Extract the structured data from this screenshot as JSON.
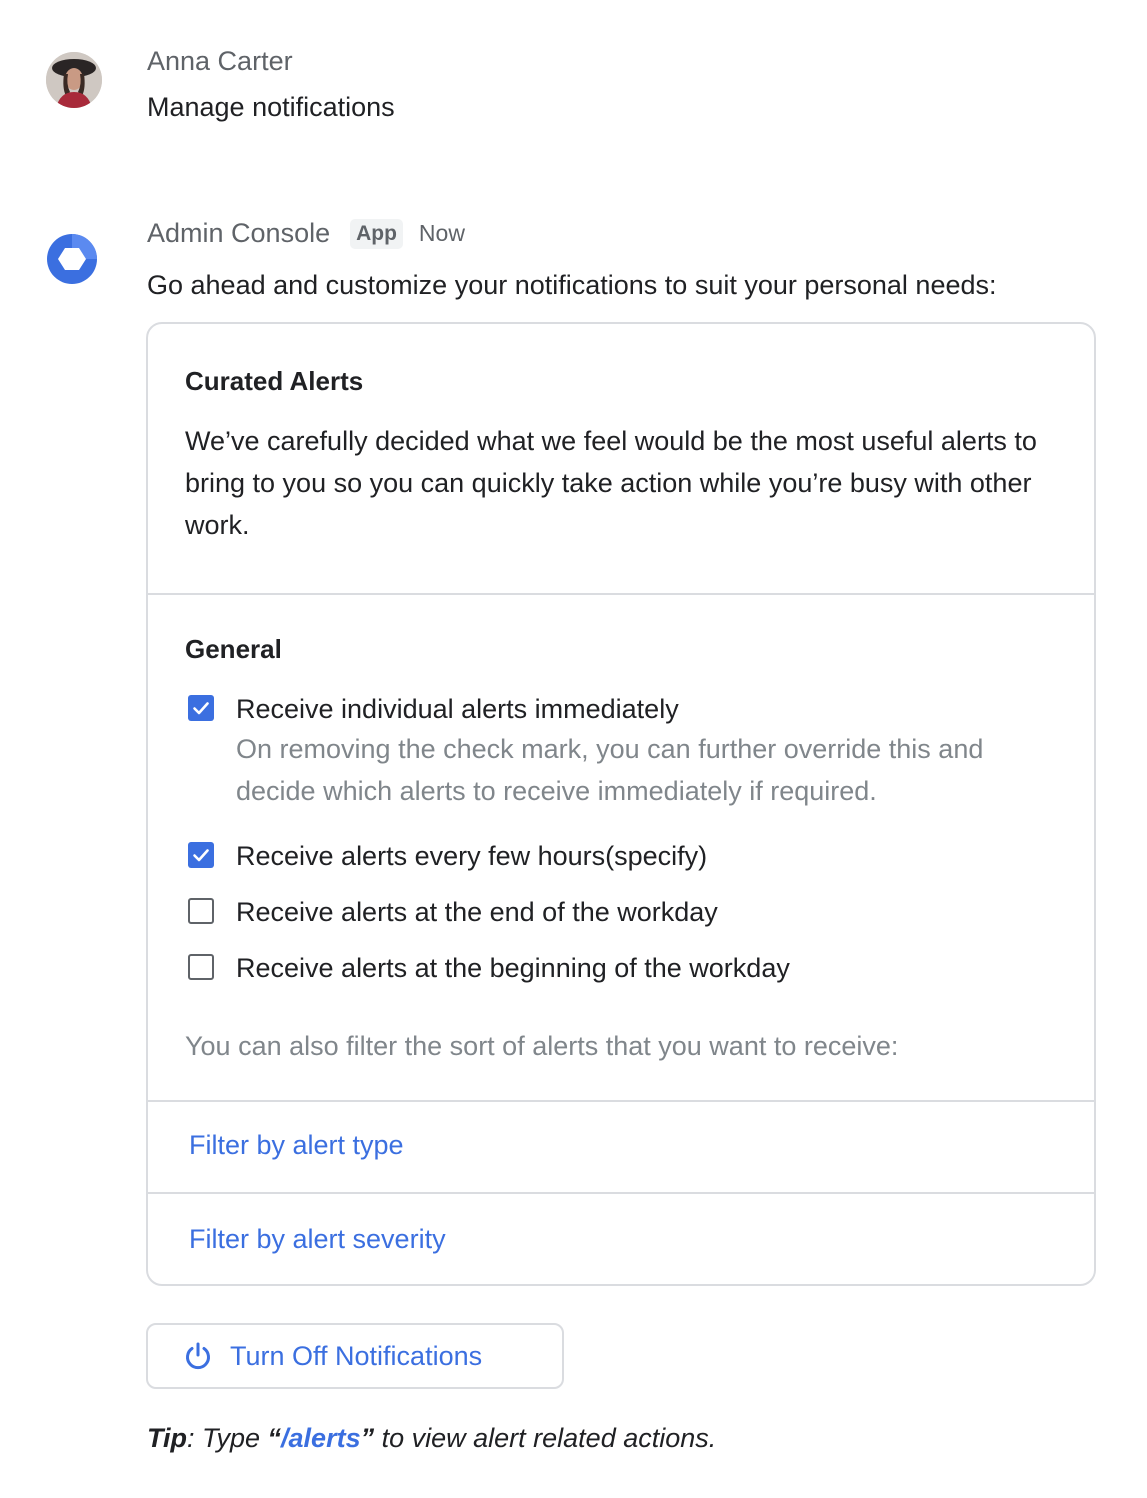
{
  "user": {
    "name": "Anna Carter",
    "message": "Manage notifications"
  },
  "app": {
    "name": "Admin Console",
    "badge": "App",
    "time": "Now",
    "intro": "Go ahead and customize your notifications to suit your personal needs:"
  },
  "card": {
    "curated": {
      "title": "Curated Alerts",
      "body": "We’ve carefully decided what we feel would be the most useful alerts to bring to you so you can quickly take action while you’re busy with other work."
    },
    "general": {
      "title": "General",
      "options": [
        {
          "label": "Receive individual alerts immediately",
          "help": "On removing the check mark, you can further override this and decide which alerts to receive immediately if required.",
          "checked": true
        },
        {
          "label": "Receive alerts every few hours(specify)",
          "checked": true
        },
        {
          "label": "Receive alerts at the end of the workday",
          "checked": false
        },
        {
          "label": "Receive alerts at the beginning of the workday",
          "checked": false
        }
      ],
      "filter_note": "You can also filter the sort of alerts that you want to receive:"
    },
    "filters": [
      "Filter by alert type",
      "Filter by alert severity"
    ]
  },
  "turn_off_button": {
    "label": "Turn Off Notifications",
    "icon": "power-icon"
  },
  "tip": {
    "prefix": "Tip",
    "text_before": ": Type ",
    "open_quote": "“",
    "command": "/alerts",
    "close_quote": "”",
    "text_after": " to view alert related actions."
  },
  "colors": {
    "accent": "#3b6fe0",
    "border": "#dadce0",
    "muted_text": "#80868b"
  }
}
